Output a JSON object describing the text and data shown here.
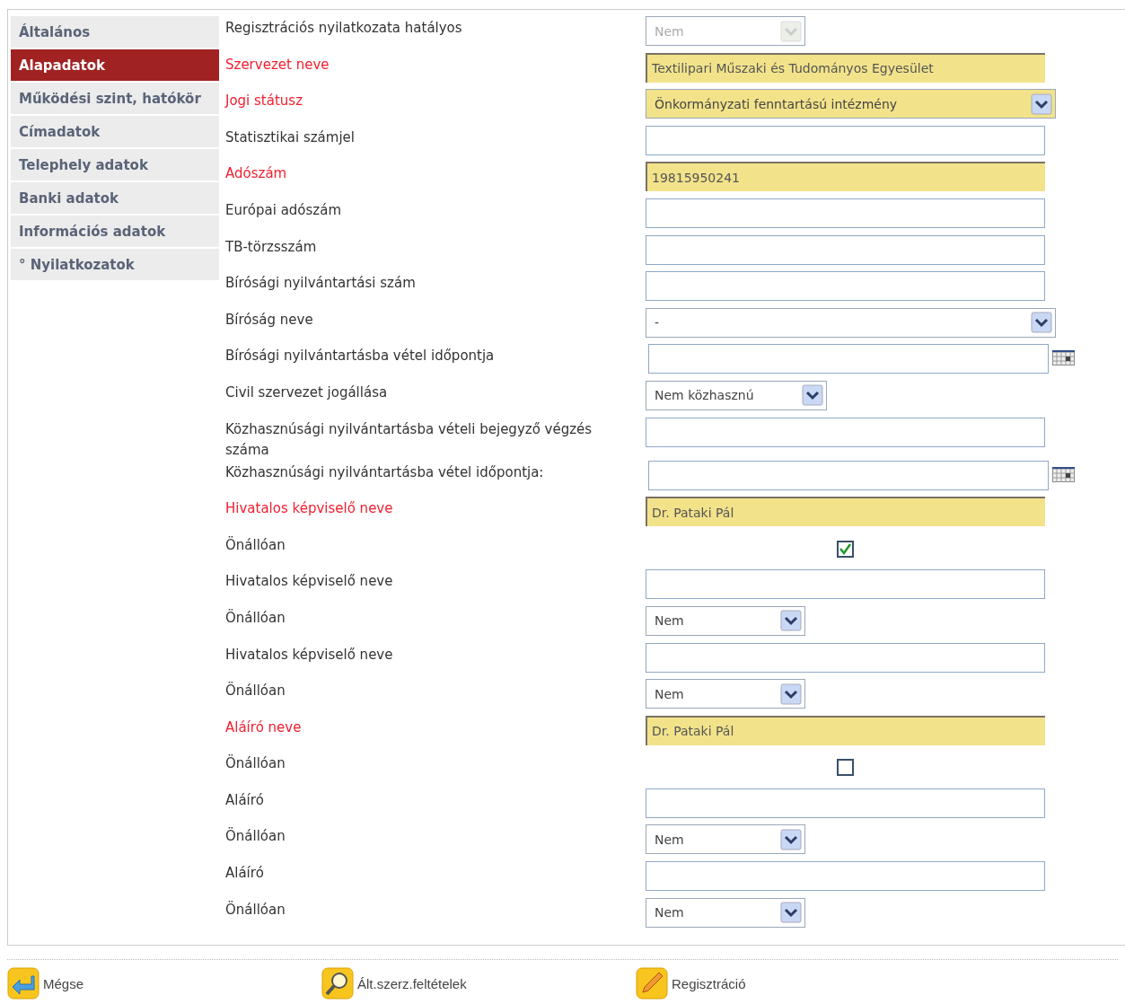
{
  "sidebar": {
    "items": [
      {
        "label": "Általános",
        "selected": false
      },
      {
        "label": "Alapadatok",
        "selected": true
      },
      {
        "label": "Működési szint, hatókör",
        "selected": false
      },
      {
        "label": "Címadatok",
        "selected": false
      },
      {
        "label": "Telephely adatok",
        "selected": false
      },
      {
        "label": "Banki adatok",
        "selected": false
      },
      {
        "label": "Információs adatok",
        "selected": false
      },
      {
        "label": "° Nyilatkozatok",
        "selected": false
      }
    ]
  },
  "form": {
    "rows": [
      {
        "label": "Regisztrációs nyilatkozata hatályos",
        "required": false,
        "kind": "select",
        "value": "Nem",
        "disabled": true
      },
      {
        "label": "Szervezet neve",
        "required": true,
        "kind": "text",
        "value": "Textilipari Műszaki és Tudományos Egyesület"
      },
      {
        "label": "Jogi státusz",
        "required": true,
        "kind": "wideselect",
        "value": "Önkormányzati fenntartású intézmény",
        "disabled": false
      },
      {
        "label": "Statisztikai számjel",
        "required": false,
        "kind": "text"
      },
      {
        "label": "Adószám",
        "required": true,
        "kind": "text",
        "value": "19815950241"
      },
      {
        "label": "Európai adószám",
        "required": false,
        "kind": "text"
      },
      {
        "label": "TB-törzsszám",
        "required": false,
        "kind": "text"
      },
      {
        "label": "Bírósági nyilvántartási szám",
        "required": false,
        "kind": "text"
      },
      {
        "label": "Bíróság neve",
        "required": false,
        "kind": "wideselect",
        "value": "-",
        "disabled": false
      },
      {
        "label": "Bírósági nyilvántartásba vétel időpontja",
        "required": false,
        "kind": "date"
      },
      {
        "label": "Civil szervezet jogállása",
        "required": false,
        "kind": "midselect",
        "value": "Nem közhasznú",
        "disabled": false
      },
      {
        "label": "Közhasznúsági nyilvántartásba vételi bejegyző végzés száma",
        "required": false,
        "kind": "text"
      },
      {
        "label": "Közhasznúsági nyilvántartásba vétel időpontja:",
        "required": false,
        "kind": "date"
      },
      {
        "label": "Hivatalos képviselő neve",
        "required": true,
        "kind": "text",
        "value": "Dr. Pataki Pál"
      },
      {
        "label": "Önállóan",
        "required": false,
        "kind": "checkbox",
        "checked": true
      },
      {
        "label": "Hivatalos képviselő neve",
        "required": false,
        "kind": "text"
      },
      {
        "label": "Önállóan",
        "required": false,
        "kind": "select",
        "value": "Nem",
        "disabled": false
      },
      {
        "label": "Hivatalos képviselő neve",
        "required": false,
        "kind": "text"
      },
      {
        "label": "Önállóan",
        "required": false,
        "kind": "select",
        "value": "Nem",
        "disabled": false
      },
      {
        "label": "Aláíró neve",
        "required": true,
        "kind": "text",
        "value": "Dr. Pataki Pál"
      },
      {
        "label": "Önállóan",
        "required": false,
        "kind": "checkbox",
        "checked": false
      },
      {
        "label": "Aláíró",
        "required": false,
        "kind": "text"
      },
      {
        "label": "Önállóan",
        "required": false,
        "kind": "select",
        "value": "Nem",
        "disabled": false
      },
      {
        "label": "Aláíró",
        "required": false,
        "kind": "text"
      },
      {
        "label": "Önállóan",
        "required": false,
        "kind": "select",
        "value": "Nem",
        "disabled": false
      }
    ]
  },
  "footer": {
    "buttons": [
      {
        "kind": "back",
        "label": "Mégse"
      },
      {
        "kind": "search",
        "label": "Ált.szerz.feltételek"
      },
      {
        "kind": "edit",
        "label": "Regisztráció"
      }
    ]
  }
}
